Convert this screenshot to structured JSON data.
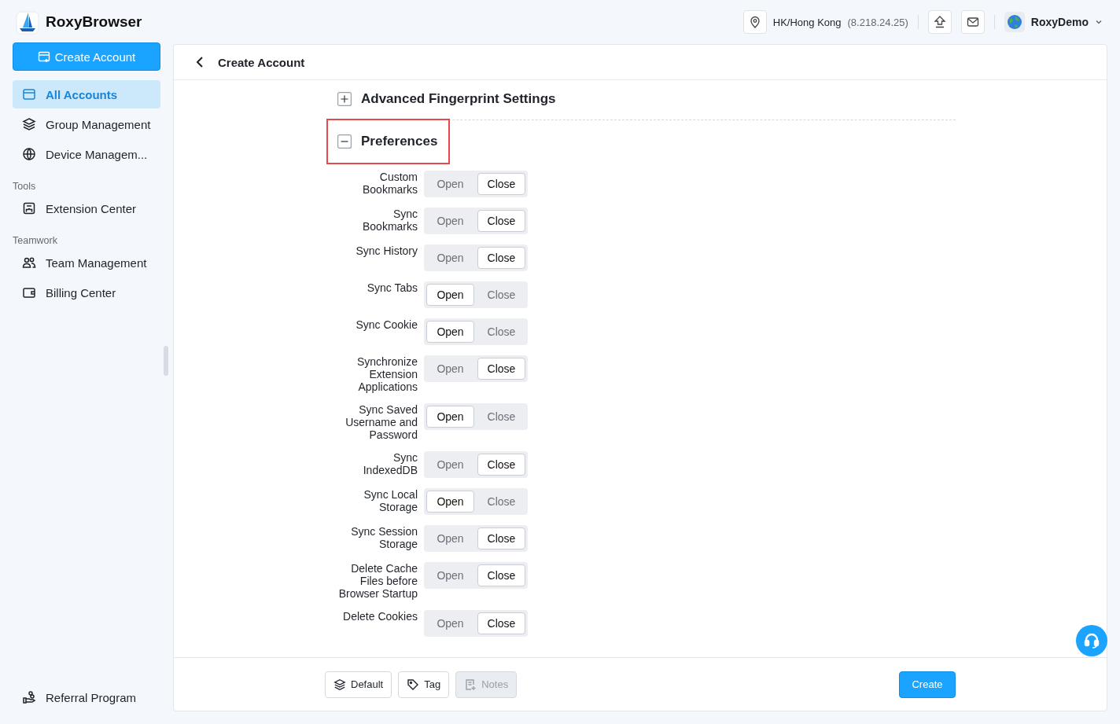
{
  "app": {
    "name": "RoxyBrowser"
  },
  "sidebar": {
    "create_button": "Create Account",
    "groups": [
      {
        "items": [
          {
            "label": "All Accounts",
            "selected": true
          },
          {
            "label": "Group Management",
            "selected": false
          },
          {
            "label": "Device Managem...",
            "selected": false
          }
        ]
      },
      {
        "heading": "Tools",
        "items": [
          {
            "label": "Extension Center",
            "selected": false
          }
        ]
      },
      {
        "heading": "Teamwork",
        "items": [
          {
            "label": "Team Management",
            "selected": false
          },
          {
            "label": "Billing Center",
            "selected": false
          }
        ]
      }
    ],
    "footer_item": {
      "label": "Referral Program"
    }
  },
  "topbar": {
    "location": "HK/Hong Kong",
    "ip": "(8.218.24.25)",
    "user": "RoxyDemo"
  },
  "page": {
    "title": "Create Account",
    "sections": [
      {
        "title": "Advanced Fingerprint Settings",
        "expanded": false,
        "highlighted": false
      },
      {
        "title": "Preferences",
        "expanded": true,
        "highlighted": true,
        "rows": [
          {
            "label": "Custom Bookmarks",
            "options": [
              {
                "label": "Open",
                "selected": false
              },
              {
                "label": "Close",
                "selected": true
              }
            ]
          },
          {
            "label": "Sync Bookmarks",
            "options": [
              {
                "label": "Open",
                "selected": false
              },
              {
                "label": "Close",
                "selected": true
              }
            ]
          },
          {
            "label": "Sync History",
            "options": [
              {
                "label": "Open",
                "selected": false
              },
              {
                "label": "Close",
                "selected": true
              }
            ]
          },
          {
            "label": "Sync Tabs",
            "options": [
              {
                "label": "Open",
                "selected": true
              },
              {
                "label": "Close",
                "selected": false
              }
            ]
          },
          {
            "label": "Sync Cookie",
            "options": [
              {
                "label": "Open",
                "selected": true
              },
              {
                "label": "Close",
                "selected": false
              }
            ]
          },
          {
            "label": "Synchronize Extension Applications",
            "options": [
              {
                "label": "Open",
                "selected": false
              },
              {
                "label": "Close",
                "selected": true
              }
            ]
          },
          {
            "label": "Sync Saved Username and Password",
            "options": [
              {
                "label": "Open",
                "selected": true
              },
              {
                "label": "Close",
                "selected": false
              }
            ]
          },
          {
            "label": "Sync IndexedDB",
            "options": [
              {
                "label": "Open",
                "selected": false
              },
              {
                "label": "Close",
                "selected": true
              }
            ]
          },
          {
            "label": "Sync Local Storage",
            "options": [
              {
                "label": "Open",
                "selected": true
              },
              {
                "label": "Close",
                "selected": false
              }
            ]
          },
          {
            "label": "Sync Session Storage",
            "options": [
              {
                "label": "Open",
                "selected": false
              },
              {
                "label": "Close",
                "selected": true
              }
            ]
          },
          {
            "label": "Delete Cache Files before Browser Startup",
            "options": [
              {
                "label": "Open",
                "selected": false
              },
              {
                "label": "Close",
                "selected": true
              }
            ]
          },
          {
            "label": "Delete Cookies",
            "options": [
              {
                "label": "Open",
                "selected": false
              },
              {
                "label": "Close",
                "selected": true
              }
            ]
          }
        ]
      }
    ]
  },
  "footer": {
    "buttons": [
      {
        "label": "Default",
        "disabled": false
      },
      {
        "label": "Tag",
        "disabled": false
      },
      {
        "label": "Notes",
        "disabled": true
      }
    ],
    "submit": "Create"
  }
}
